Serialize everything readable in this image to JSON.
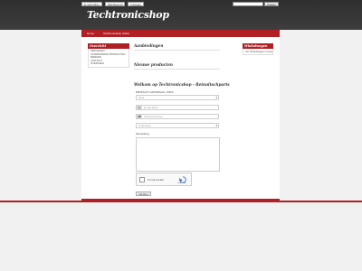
{
  "top_links": [
    "E-mail adres",
    "Wachtwoord",
    "Inloggen"
  ],
  "search_button": "Zoeken",
  "logo": "Techtronicshop",
  "nav": [
    "Home",
    "Techtronicshop drinks"
  ],
  "left_box": {
    "title": "Overzicht",
    "items": [
      "ARTIKELEN",
      "AFTERMARKETPRODUCTEN",
      "MERKEN",
      "CONTACT",
      "OVERIGEN"
    ]
  },
  "right_box": {
    "title": "Winkelwagen",
    "body": "Uw winkelwagen is leeg"
  },
  "headings": {
    "aanbiedingen": "Aanbiedingen",
    "nieuwe": "Nieuwe producten",
    "welkom": "Welkom op Techtronicshop - Reinuitschparts"
  },
  "form": {
    "label_product": "PRODUCT AANVRAAG / INFO",
    "select1": "Merk",
    "field_email": "E-mail adres",
    "field_phone": "Telefoonnummer",
    "select2": "Onderwerp",
    "label_opmerking": "Opmerking",
    "captcha_label": "I'm not a robot",
    "captcha_sub": "reCAPTCHA",
    "submit": "Verstuur"
  }
}
